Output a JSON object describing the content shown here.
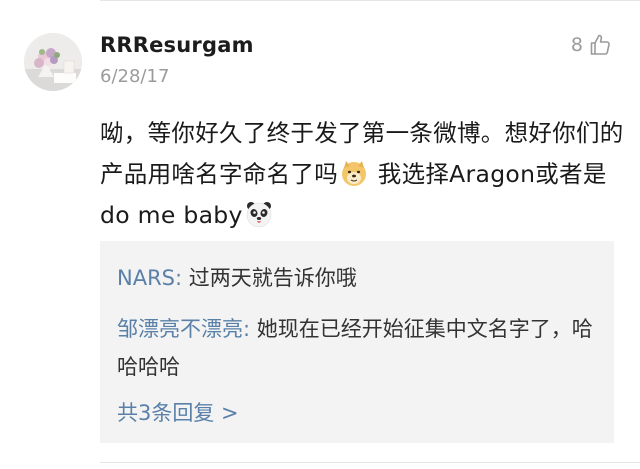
{
  "comment": {
    "username": "RRResurgam",
    "date": "6/28/17",
    "like_count": "8",
    "text_part1": "呦，等你好久了终于发了第一条微博。想好你们的产品用啥名字命名了吗",
    "text_part2": " 我选择Aragon或者是do me baby",
    "icons": {
      "avatar": "flower-bouquet-avatar",
      "like": "thumbs-up-icon",
      "emoji1": "doge-emoji",
      "emoji2": "panda-emoji"
    }
  },
  "replies": [
    {
      "author": "NARS",
      "separator": ": ",
      "text": "过两天就告诉你哦"
    },
    {
      "author": "邹漂亮不漂亮",
      "separator": ": ",
      "text": "她现在已经开始征集中文名字了，哈哈哈哈"
    }
  ],
  "more_replies": "共3条回复 >",
  "colors": {
    "link": "#5a80a8",
    "muted": "#9b9b9b",
    "reply_bg": "#f3f3f3"
  }
}
